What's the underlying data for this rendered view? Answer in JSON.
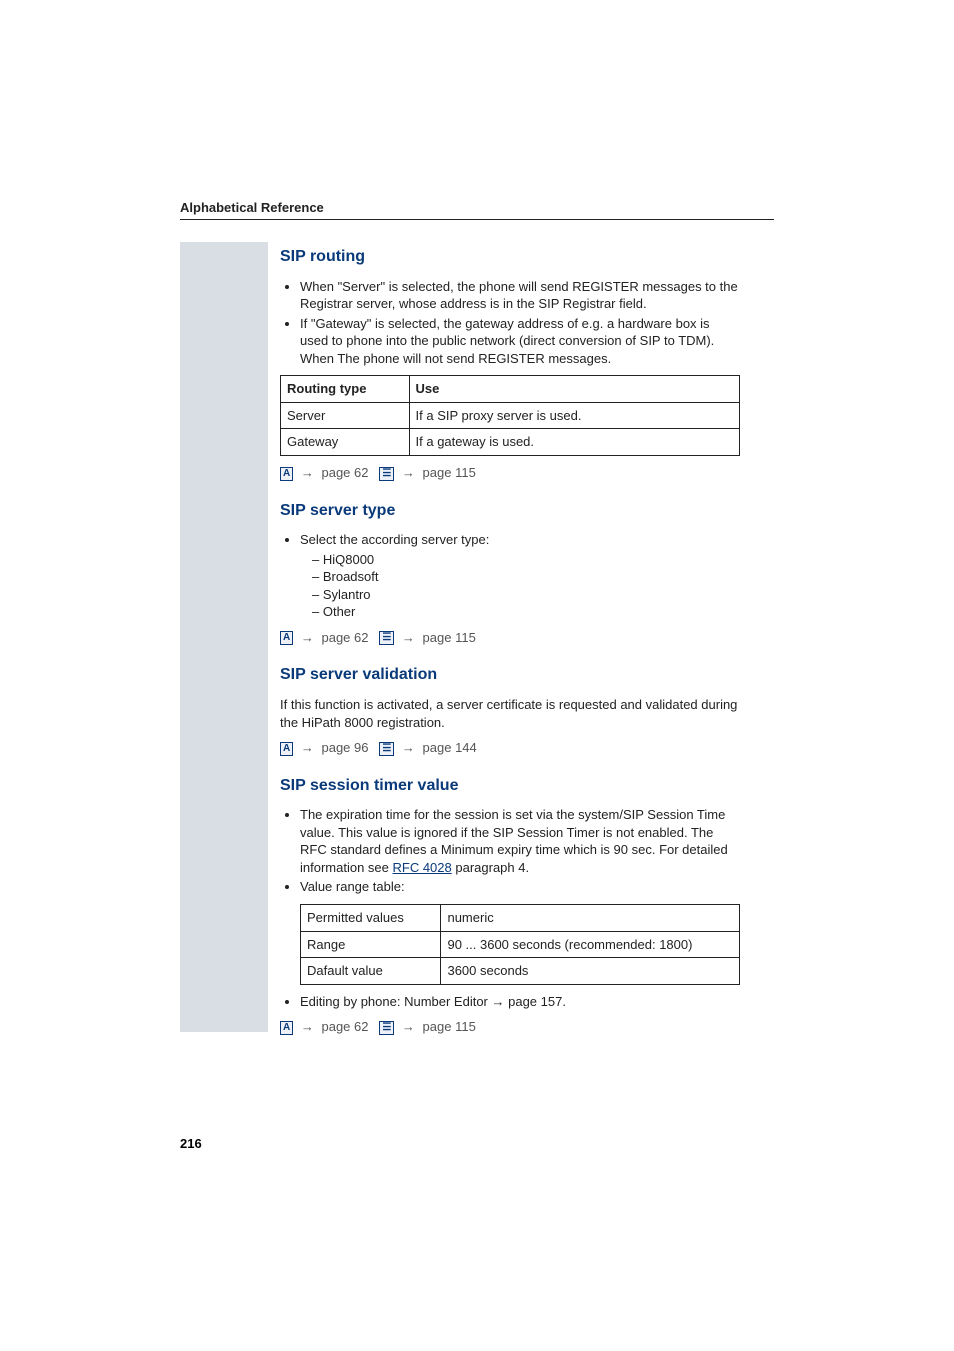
{
  "running_head": "Alphabetical Reference",
  "page_number": "216",
  "s1": {
    "title": "SIP routing",
    "b1": "When \"Server\" is selected, the phone will send REGISTER messages to the Registrar server, whose address is in the SIP Registrar field.",
    "b2": "If \"Gateway\" is selected, the gateway address of e.g. a hardware box is used to phone into the public network (direct conversion of SIP to TDM). When The phone will not send REGISTER messages.",
    "th1": "Routing type",
    "th2": "Use",
    "r1c1": "Server",
    "r1c2": "If a SIP proxy server is used.",
    "r2c1": "Gateway",
    "r2c2": "If a gateway is used.",
    "refA": "page 62",
    "refB": "page 115"
  },
  "s2": {
    "title": "SIP server type",
    "b1": "Select the according server type:",
    "d1": "HiQ8000",
    "d2": "Broadsoft",
    "d3": "Sylantro",
    "d4": "Other",
    "refA": "page 62",
    "refB": "page 115"
  },
  "s3": {
    "title": "SIP server validation",
    "body": "If this function is activated, a server certificate is requested and validated during the HiPath 8000 registration.",
    "refA": "page 96",
    "refB": "page 144"
  },
  "s4": {
    "title": "SIP session timer value",
    "b1a": "The expiration time for the session is set via the system/SIP Session Time value. This value is ignored if the SIP Session Timer is not enabled. The RFC standard defines a Minimum expiry time which is 90 sec. For detailed information see ",
    "rfc": "RFC 4028",
    "b1b": " paragraph 4.",
    "b2": "Value range table:",
    "r1c1": "Permitted values",
    "r1c2": "numeric",
    "r2c1": "Range",
    "r2c2": "90 ... 3600 seconds (recommended: 1800)",
    "r3c1": "Dafault value",
    "r3c2": "3600 seconds",
    "b3a": "Editing by phone: Number Editor ",
    "b3arrow": "→",
    "b3b": " page 157.",
    "refA": "page 62",
    "refB": "page 115"
  },
  "icons": {
    "a": "A",
    "arrow": "→"
  }
}
